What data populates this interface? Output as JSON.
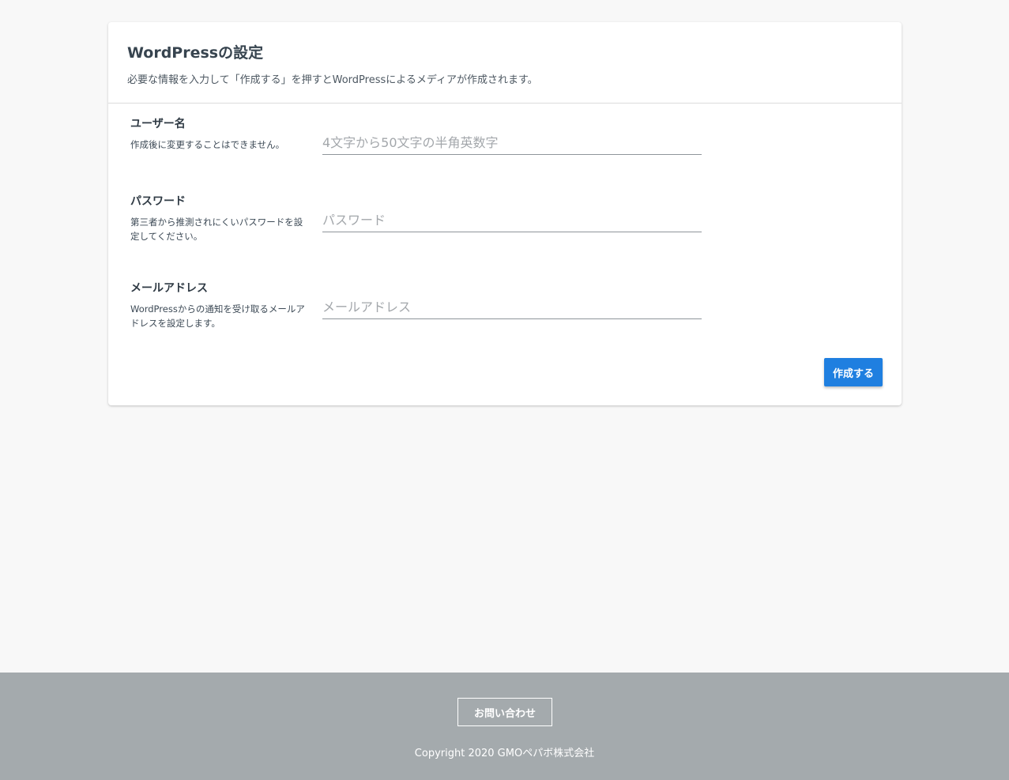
{
  "header": {
    "title": "WordPressの設定",
    "description": "必要な情報を入力して「作成する」を押すとWordPressによるメディアが作成されます。"
  },
  "form": {
    "fields": [
      {
        "label": "ユーザー名",
        "help": "作成後に変更することはできません。",
        "placeholder": "4文字から50文字の半角英数字",
        "value": ""
      },
      {
        "label": "パスワード",
        "help": "第三者から推測されにくいパスワードを設定してください。",
        "placeholder": "パスワード",
        "value": ""
      },
      {
        "label": "メールアドレス",
        "help": "WordPressからの通知を受け取るメールアドレスを設定します。",
        "placeholder": "メールアドレス",
        "value": ""
      }
    ],
    "submit_label": "作成する"
  },
  "footer": {
    "contact_label": "お問い合わせ",
    "copyright": "Copyright 2020 GMOペパボ株式会社"
  },
  "colors": {
    "background": "#f8f8f8",
    "primary_button": "#1f7fe0",
    "footer_background": "#a4aaad"
  }
}
